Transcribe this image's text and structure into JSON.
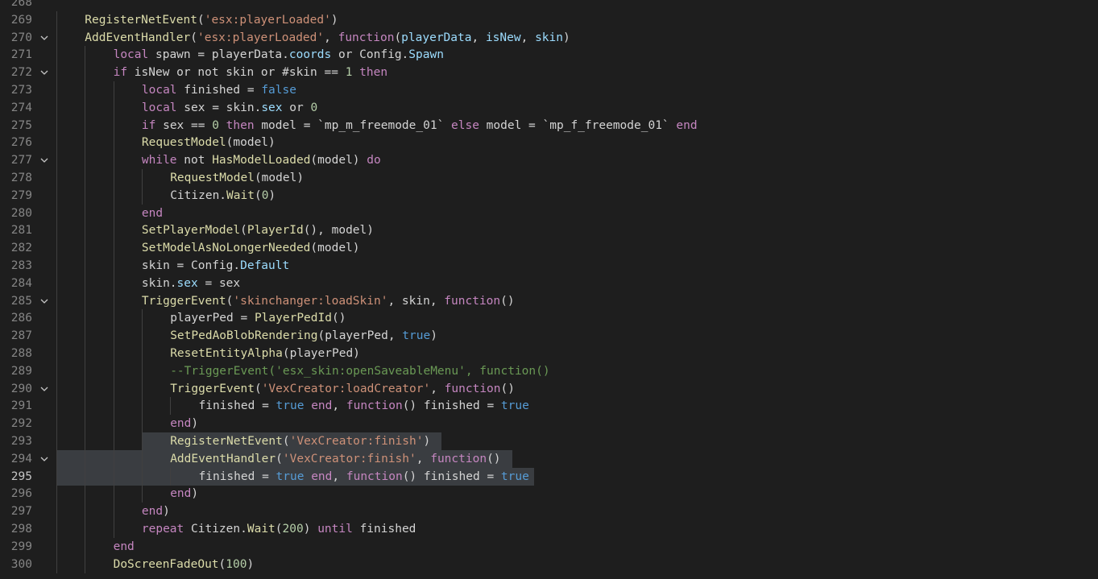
{
  "editor": {
    "theme": {
      "background": "#1e1e1e",
      "keyword": "#c586c0",
      "function": "#dcdcaa",
      "string": "#ce9178",
      "number": "#b5cea8",
      "boolean": "#569cd6",
      "field": "#9cdcfe",
      "comment": "#6a9955",
      "selection": "#3a3d41"
    },
    "active_line": 295,
    "lines": [
      {
        "n": 268,
        "fold": false,
        "indent": 0,
        "tokens": []
      },
      {
        "n": 269,
        "fold": false,
        "indent": 1,
        "tokens": [
          [
            "fn",
            "RegisterNetEvent"
          ],
          [
            "p",
            "("
          ],
          [
            "str",
            "'esx:playerLoaded'"
          ],
          [
            "p",
            ")"
          ]
        ]
      },
      {
        "n": 270,
        "fold": true,
        "indent": 1,
        "tokens": [
          [
            "fn",
            "AddEventHandler"
          ],
          [
            "p",
            "("
          ],
          [
            "str",
            "'esx:playerLoaded'"
          ],
          [
            "p",
            ", "
          ],
          [
            "kw",
            "function"
          ],
          [
            "p",
            "("
          ],
          [
            "fld",
            "playerData"
          ],
          [
            "p",
            ", "
          ],
          [
            "fld",
            "isNew"
          ],
          [
            "p",
            ", "
          ],
          [
            "fld",
            "skin"
          ],
          [
            "p",
            ")"
          ]
        ]
      },
      {
        "n": 271,
        "fold": false,
        "indent": 2,
        "tokens": [
          [
            "kw",
            "local"
          ],
          [
            "p",
            " spawn = playerData."
          ],
          [
            "fld",
            "coords"
          ],
          [
            "p",
            " or Config."
          ],
          [
            "fld",
            "Spawn"
          ]
        ]
      },
      {
        "n": 272,
        "fold": true,
        "indent": 2,
        "tokens": [
          [
            "kw",
            "if"
          ],
          [
            "p",
            " isNew or not skin or #skin == "
          ],
          [
            "num",
            "1"
          ],
          [
            "p",
            " "
          ],
          [
            "kw",
            "then"
          ]
        ]
      },
      {
        "n": 273,
        "fold": false,
        "indent": 3,
        "tokens": [
          [
            "kw",
            "local"
          ],
          [
            "p",
            " finished = "
          ],
          [
            "bool",
            "false"
          ]
        ]
      },
      {
        "n": 274,
        "fold": false,
        "indent": 3,
        "tokens": [
          [
            "kw",
            "local"
          ],
          [
            "p",
            " sex = skin."
          ],
          [
            "fld",
            "sex"
          ],
          [
            "p",
            " or "
          ],
          [
            "num",
            "0"
          ]
        ]
      },
      {
        "n": 275,
        "fold": false,
        "indent": 3,
        "tokens": [
          [
            "kw",
            "if"
          ],
          [
            "p",
            " sex == "
          ],
          [
            "num",
            "0"
          ],
          [
            "p",
            " "
          ],
          [
            "kw",
            "then"
          ],
          [
            "p",
            " model = `mp_m_freemode_01` "
          ],
          [
            "kw",
            "else"
          ],
          [
            "p",
            " model = `mp_f_freemode_01` "
          ],
          [
            "kw",
            "end"
          ]
        ]
      },
      {
        "n": 276,
        "fold": false,
        "indent": 3,
        "tokens": [
          [
            "fn",
            "RequestModel"
          ],
          [
            "p",
            "(model)"
          ]
        ]
      },
      {
        "n": 277,
        "fold": true,
        "indent": 3,
        "tokens": [
          [
            "kw",
            "while"
          ],
          [
            "p",
            " not "
          ],
          [
            "fn",
            "HasModelLoaded"
          ],
          [
            "p",
            "(model) "
          ],
          [
            "kw",
            "do"
          ]
        ]
      },
      {
        "n": 278,
        "fold": false,
        "indent": 4,
        "tokens": [
          [
            "fn",
            "RequestModel"
          ],
          [
            "p",
            "(model)"
          ]
        ]
      },
      {
        "n": 279,
        "fold": false,
        "indent": 4,
        "tokens": [
          [
            "p",
            "Citizen."
          ],
          [
            "fn",
            "Wait"
          ],
          [
            "p",
            "("
          ],
          [
            "num",
            "0"
          ],
          [
            "p",
            ")"
          ]
        ]
      },
      {
        "n": 280,
        "fold": false,
        "indent": 3,
        "tokens": [
          [
            "kw",
            "end"
          ]
        ]
      },
      {
        "n": 281,
        "fold": false,
        "indent": 3,
        "tokens": [
          [
            "fn",
            "SetPlayerModel"
          ],
          [
            "p",
            "("
          ],
          [
            "fn",
            "PlayerId"
          ],
          [
            "p",
            "(), model)"
          ]
        ]
      },
      {
        "n": 282,
        "fold": false,
        "indent": 3,
        "tokens": [
          [
            "fn",
            "SetModelAsNoLongerNeeded"
          ],
          [
            "p",
            "(model)"
          ]
        ]
      },
      {
        "n": 283,
        "fold": false,
        "indent": 3,
        "tokens": [
          [
            "p",
            "skin = Config."
          ],
          [
            "fld",
            "Default"
          ]
        ]
      },
      {
        "n": 284,
        "fold": false,
        "indent": 3,
        "tokens": [
          [
            "p",
            "skin."
          ],
          [
            "fld",
            "sex"
          ],
          [
            "p",
            " = sex"
          ]
        ]
      },
      {
        "n": 285,
        "fold": true,
        "indent": 3,
        "tokens": [
          [
            "fn",
            "TriggerEvent"
          ],
          [
            "p",
            "("
          ],
          [
            "str",
            "'skinchanger:loadSkin'"
          ],
          [
            "p",
            ", skin, "
          ],
          [
            "kw",
            "function"
          ],
          [
            "p",
            "()"
          ]
        ]
      },
      {
        "n": 286,
        "fold": false,
        "indent": 4,
        "tokens": [
          [
            "p",
            "playerPed = "
          ],
          [
            "fn",
            "PlayerPedId"
          ],
          [
            "p",
            "()"
          ]
        ]
      },
      {
        "n": 287,
        "fold": false,
        "indent": 4,
        "tokens": [
          [
            "fn",
            "SetPedAoBlobRendering"
          ],
          [
            "p",
            "(playerPed, "
          ],
          [
            "bool",
            "true"
          ],
          [
            "p",
            ")"
          ]
        ]
      },
      {
        "n": 288,
        "fold": false,
        "indent": 4,
        "tokens": [
          [
            "fn",
            "ResetEntityAlpha"
          ],
          [
            "p",
            "(playerPed)"
          ]
        ]
      },
      {
        "n": 289,
        "fold": false,
        "indent": 4,
        "tokens": [
          [
            "com",
            "--TriggerEvent('esx_skin:openSaveableMenu', function()"
          ]
        ]
      },
      {
        "n": 290,
        "fold": true,
        "indent": 4,
        "tokens": [
          [
            "fn",
            "TriggerEvent"
          ],
          [
            "p",
            "("
          ],
          [
            "str",
            "'VexCreator:loadCreator'"
          ],
          [
            "p",
            ", "
          ],
          [
            "kw",
            "function"
          ],
          [
            "p",
            "()"
          ]
        ]
      },
      {
        "n": 291,
        "fold": false,
        "indent": 5,
        "tokens": [
          [
            "p",
            "finished = "
          ],
          [
            "bool",
            "true"
          ],
          [
            "p",
            " "
          ],
          [
            "kw",
            "end"
          ],
          [
            "p",
            ", "
          ],
          [
            "kw",
            "function"
          ],
          [
            "p",
            "() finished = "
          ],
          [
            "bool",
            "true"
          ]
        ]
      },
      {
        "n": 292,
        "fold": false,
        "indent": 4,
        "tokens": [
          [
            "kw",
            "end"
          ],
          [
            "p",
            ")"
          ]
        ]
      },
      {
        "n": 293,
        "fold": false,
        "indent": 4,
        "sel": [
          176,
          548
        ],
        "tokens": [
          [
            "fn",
            "RegisterNetEvent"
          ],
          [
            "p",
            "("
          ],
          [
            "str",
            "'VexCreator:finish'"
          ],
          [
            "p",
            ")"
          ]
        ]
      },
      {
        "n": 294,
        "fold": true,
        "indent": 4,
        "sel": [
          70,
          636
        ],
        "tokens": [
          [
            "fn",
            "AddEventHandler"
          ],
          [
            "p",
            "("
          ],
          [
            "str",
            "'VexCreator:finish'"
          ],
          [
            "p",
            ", "
          ],
          [
            "kw",
            "function"
          ],
          [
            "p",
            "()"
          ]
        ]
      },
      {
        "n": 295,
        "fold": false,
        "indent": 5,
        "sel": [
          70,
          663
        ],
        "tokens": [
          [
            "p",
            "finished = "
          ],
          [
            "bool",
            "true"
          ],
          [
            "p",
            " "
          ],
          [
            "kw",
            "end"
          ],
          [
            "p",
            ", "
          ],
          [
            "kw",
            "function"
          ],
          [
            "p",
            "() finished = "
          ],
          [
            "bool",
            "true"
          ]
        ]
      },
      {
        "n": 296,
        "fold": false,
        "indent": 4,
        "tokens": [
          [
            "kw",
            "end"
          ],
          [
            "p",
            ")"
          ]
        ]
      },
      {
        "n": 297,
        "fold": false,
        "indent": 3,
        "tokens": [
          [
            "kw",
            "end"
          ],
          [
            "p",
            ")"
          ]
        ]
      },
      {
        "n": 298,
        "fold": false,
        "indent": 3,
        "tokens": [
          [
            "kw",
            "repeat"
          ],
          [
            "p",
            " Citizen."
          ],
          [
            "fn",
            "Wait"
          ],
          [
            "p",
            "("
          ],
          [
            "num",
            "200"
          ],
          [
            "p",
            ") "
          ],
          [
            "kw",
            "until"
          ],
          [
            "p",
            " finished"
          ]
        ]
      },
      {
        "n": 299,
        "fold": false,
        "indent": 2,
        "tokens": [
          [
            "kw",
            "end"
          ]
        ]
      },
      {
        "n": 300,
        "fold": false,
        "indent": 2,
        "tokens": [
          [
            "fn",
            "DoScreenFadeOut"
          ],
          [
            "p",
            "("
          ],
          [
            "num",
            "100"
          ],
          [
            "p",
            ")"
          ]
        ]
      }
    ]
  }
}
